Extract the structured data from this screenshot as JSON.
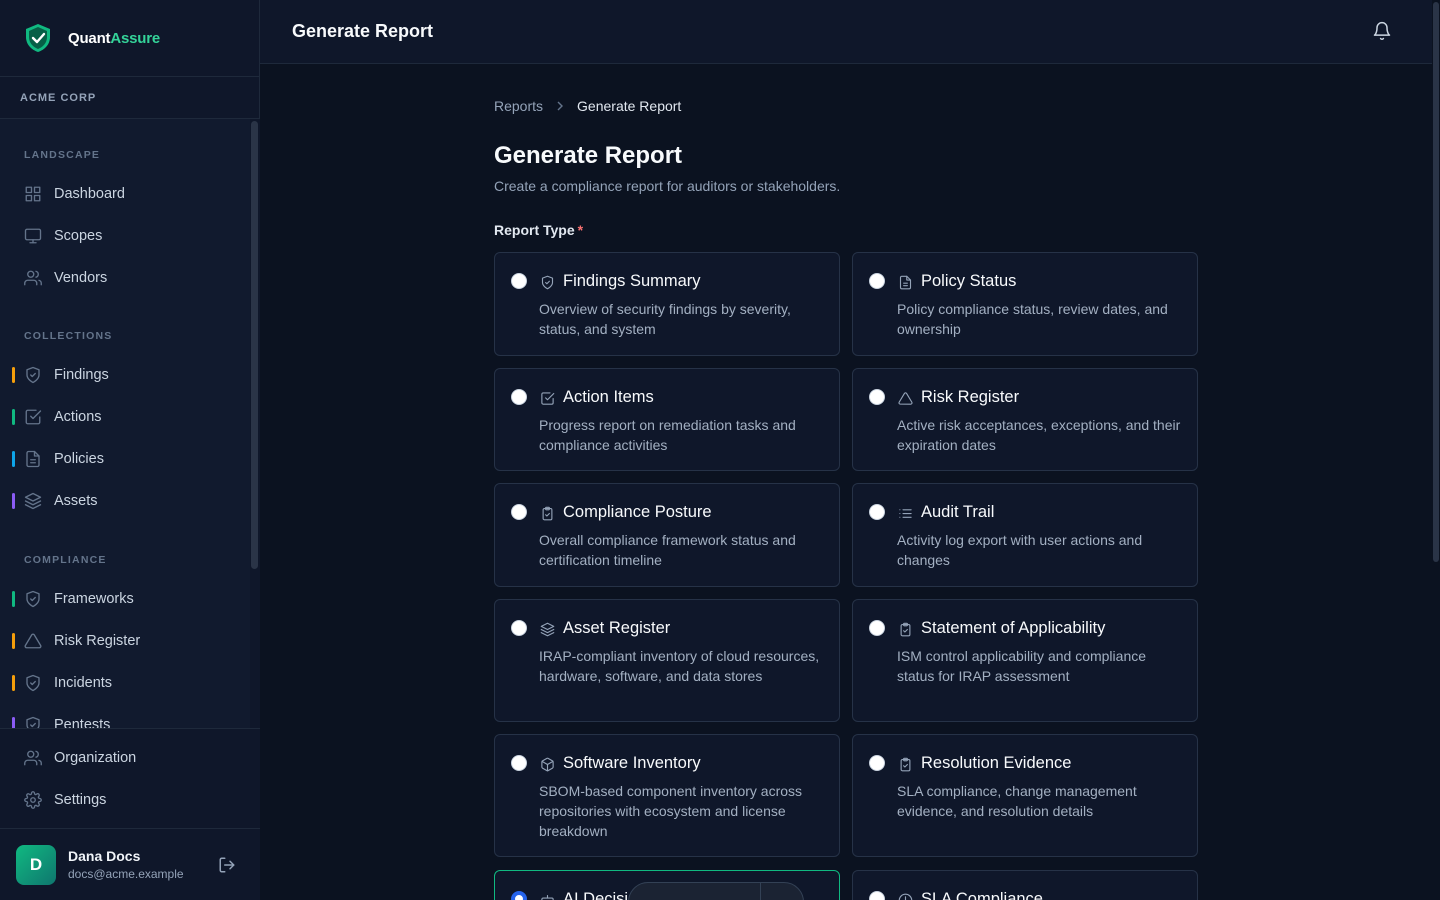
{
  "brand": {
    "name_part1": "Quant",
    "name_part2": "Assure"
  },
  "org_name": "ACME CORP",
  "sidebar": {
    "sections": [
      {
        "title": "LANDSCAPE",
        "items": [
          {
            "label": "Dashboard",
            "icon": "grid-icon"
          },
          {
            "label": "Scopes",
            "icon": "monitor-icon"
          },
          {
            "label": "Vendors",
            "icon": "users-icon"
          }
        ]
      },
      {
        "title": "COLLECTIONS",
        "items": [
          {
            "label": "Findings",
            "icon": "shield-icon",
            "accent": "#f59e0b"
          },
          {
            "label": "Actions",
            "icon": "check-square-icon",
            "accent": "#10b981"
          },
          {
            "label": "Policies",
            "icon": "file-icon",
            "accent": "#0ea5e9"
          },
          {
            "label": "Assets",
            "icon": "layers-icon",
            "accent": "#8b5cf6"
          }
        ]
      },
      {
        "title": "COMPLIANCE",
        "items": [
          {
            "label": "Frameworks",
            "icon": "shield-icon",
            "accent": "#10b981"
          },
          {
            "label": "Risk Register",
            "icon": "alert-triangle-icon",
            "accent": "#f59e0b"
          },
          {
            "label": "Incidents",
            "icon": "shield-icon",
            "accent": "#f59e0b"
          },
          {
            "label": "Pentests",
            "icon": "shield-icon",
            "accent": "#8b5cf6"
          }
        ]
      }
    ],
    "bottom_items": [
      {
        "label": "Organization",
        "icon": "users-icon"
      },
      {
        "label": "Settings",
        "icon": "gear-icon"
      }
    ]
  },
  "user": {
    "initial": "D",
    "name": "Dana Docs",
    "email": "docs@acme.example"
  },
  "header": {
    "title": "Generate Report"
  },
  "breadcrumb": {
    "parent": "Reports",
    "current": "Generate Report"
  },
  "page": {
    "title": "Generate Report",
    "subtitle": "Create a compliance report for auditors or stakeholders.",
    "report_type_label": "Report Type",
    "required_mark": "*"
  },
  "report_types": [
    {
      "title": "Findings Summary",
      "desc": "Overview of security findings by severity, status, and system",
      "icon": "shield-icon",
      "selected": false
    },
    {
      "title": "Policy Status",
      "desc": "Policy compliance status, review dates, and ownership",
      "icon": "file-icon",
      "selected": false
    },
    {
      "title": "Action Items",
      "desc": "Progress report on remediation tasks and compliance activities",
      "icon": "check-square-icon",
      "selected": false
    },
    {
      "title": "Risk Register",
      "desc": "Active risk acceptances, exceptions, and their expiration dates",
      "icon": "alert-triangle-icon",
      "selected": false
    },
    {
      "title": "Compliance Posture",
      "desc": "Overall compliance framework status and certification timeline",
      "icon": "clipboard-check-icon",
      "selected": false
    },
    {
      "title": "Audit Trail",
      "desc": "Activity log export with user actions and changes",
      "icon": "list-icon",
      "selected": false
    },
    {
      "title": "Asset Register",
      "desc": "IRAP-compliant inventory of cloud resources, hardware, software, and data stores",
      "icon": "layers-icon",
      "selected": false
    },
    {
      "title": "Statement of Applicability",
      "desc": "ISM control applicability and compliance status for IRAP assessment",
      "icon": "clipboard-check-icon",
      "selected": false
    },
    {
      "title": "Software Inventory",
      "desc": "SBOM-based component inventory across repositories with ecosystem and license breakdown",
      "icon": "package-icon",
      "selected": false
    },
    {
      "title": "Resolution Evidence",
      "desc": "SLA compliance, change management evidence, and resolution details",
      "icon": "clipboard-check-icon",
      "selected": false
    },
    {
      "title": "AI Decisi",
      "desc": "",
      "icon": "bot-icon",
      "selected": true
    },
    {
      "title": "SLA Compliance",
      "desc": "",
      "icon": "clock-icon",
      "selected": false
    }
  ]
}
